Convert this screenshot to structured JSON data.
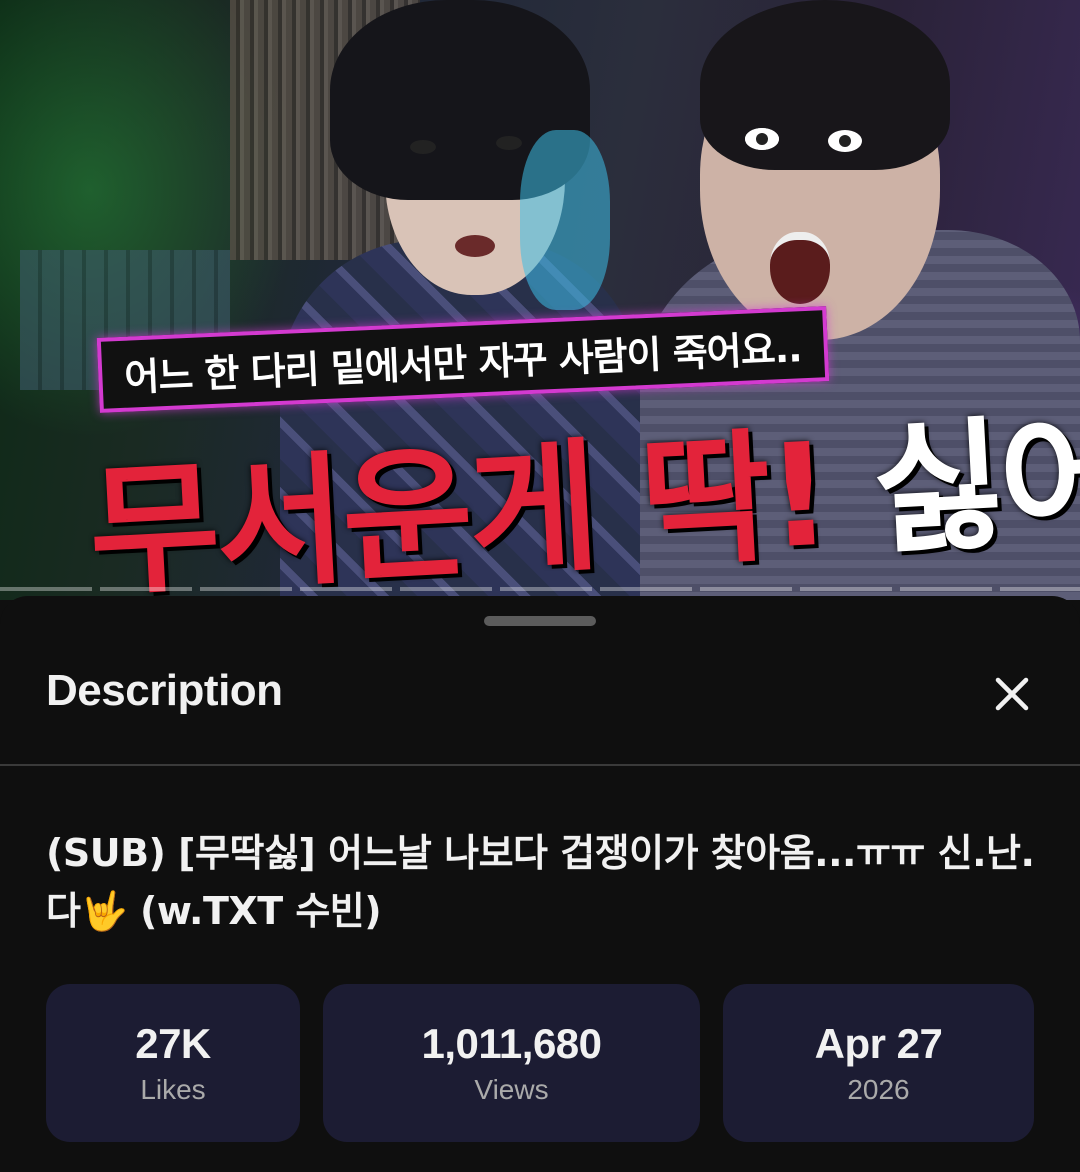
{
  "thumbnail": {
    "caption": "어느 한 다리 밑에서만 자꾸 사람이 죽어요..",
    "headline_part1": "무서운게",
    "headline_part2": "딱!",
    "headline_part3": "싫어"
  },
  "sheet": {
    "title": "Description",
    "close_icon": "close-icon",
    "video_title": "(SUB) [무딱싫] 어느날 나보다 겁쟁이가 찾아옴...ㅠㅠ 신.난.다🤟 (w.TXT 수빈)"
  },
  "stats": [
    {
      "value": "27K",
      "label": "Likes"
    },
    {
      "value": "1,011,680",
      "label": "Views"
    },
    {
      "value": "Apr 27",
      "label": "2026"
    }
  ],
  "colors": {
    "background": "#0f0f0f",
    "stat_card": "#1c1c33",
    "headline_red": "#e3233a",
    "caption_border": "#d33ad0"
  }
}
